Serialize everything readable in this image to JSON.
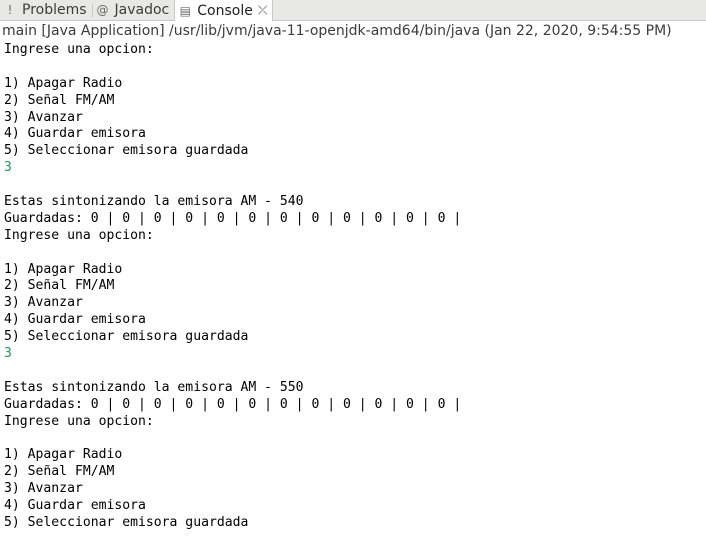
{
  "tabs": [
    {
      "label": "Problems",
      "icon": "problems-icon",
      "glyph": "!"
    },
    {
      "label": "Javadoc",
      "icon": "javadoc-icon",
      "glyph": "@"
    },
    {
      "label": "Console",
      "icon": "console-icon",
      "glyph": "▤",
      "active": true,
      "close_glyph": "⤫"
    }
  ],
  "status": "main [Java Application] /usr/lib/jvm/java-11-openjdk-amd64/bin/java (Jan 22, 2020, 9:54:55 PM)",
  "console": {
    "lines": [
      "Ingrese una opcion:",
      "",
      "1) Apagar Radio",
      "2) Señal FM/AM",
      "3) Avanzar",
      "4) Guardar emisora",
      "5) Seleccionar emisora guardada",
      "3",
      "",
      "Estas sintonizando la emisora AM - 540",
      "Guardadas: 0 | 0 | 0 | 0 | 0 | 0 | 0 | 0 | 0 | 0 | 0 | 0 |",
      "Ingrese una opcion:",
      "",
      "1) Apagar Radio",
      "2) Señal FM/AM",
      "3) Avanzar",
      "4) Guardar emisora",
      "5) Seleccionar emisora guardada",
      "3",
      "",
      "Estas sintonizando la emisora AM - 550",
      "Guardadas: 0 | 0 | 0 | 0 | 0 | 0 | 0 | 0 | 0 | 0 | 0 | 0 |",
      "Ingrese una opcion:",
      "",
      "1) Apagar Radio",
      "2) Señal FM/AM",
      "3) Avanzar",
      "4) Guardar emisora",
      "5) Seleccionar emisora guardada"
    ],
    "user_input_color": "#1e9c5c",
    "output_color": "#000000"
  }
}
